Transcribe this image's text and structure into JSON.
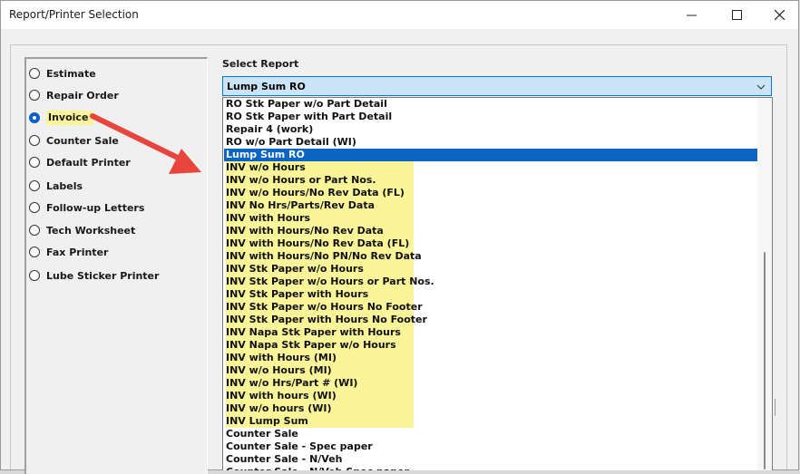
{
  "window": {
    "title": "Report/Printer Selection",
    "minimize_icon": "minimize-icon",
    "maximize_icon": "maximize-icon",
    "close_icon": "close-icon"
  },
  "report_group": {
    "options": [
      {
        "label": "Estimate",
        "checked": false
      },
      {
        "label": "Repair Order",
        "checked": false
      },
      {
        "label": "Invoice",
        "checked": true,
        "highlighted": true
      },
      {
        "label": "Counter Sale",
        "checked": false
      },
      {
        "label": "Default Printer",
        "checked": false
      },
      {
        "label": "Labels",
        "checked": false
      },
      {
        "label": "Follow-up Letters",
        "checked": false
      },
      {
        "label": "Tech Worksheet",
        "checked": false
      },
      {
        "label": "Fax Printer",
        "checked": false
      },
      {
        "label": "Lube Sticker Printer",
        "checked": false
      }
    ]
  },
  "select_report": {
    "label": "Select Report",
    "current_value": "Lump Sum RO",
    "items": [
      {
        "text": "RO Stk Paper w/o Part Detail"
      },
      {
        "text": "RO Stk Paper with Part Detail"
      },
      {
        "text": "Repair 4 (work)"
      },
      {
        "text": "RO w/o Part Detail (WI)"
      },
      {
        "text": "Lump Sum RO",
        "selected": true
      },
      {
        "text": "INV w/o Hours",
        "highlighted": true
      },
      {
        "text": "INV w/o Hours or Part Nos.",
        "highlighted": true
      },
      {
        "text": "INV w/o Hours/No Rev Data (FL)",
        "highlighted": true
      },
      {
        "text": "INV No Hrs/Parts/Rev Data",
        "highlighted": true
      },
      {
        "text": "INV with Hours",
        "highlighted": true
      },
      {
        "text": "INV with Hours/No Rev Data",
        "highlighted": true
      },
      {
        "text": "INV with Hours/No Rev Data (FL)",
        "highlighted": true
      },
      {
        "text": "INV with Hours/No PN/No Rev Data",
        "highlighted": true
      },
      {
        "text": "INV Stk Paper w/o Hours",
        "highlighted": true
      },
      {
        "text": "INV Stk Paper w/o Hours or Part Nos.",
        "highlighted": true
      },
      {
        "text": "INV Stk Paper with Hours",
        "highlighted": true
      },
      {
        "text": "INV Stk Paper w/o Hours No Footer",
        "highlighted": true
      },
      {
        "text": "INV Stk Paper with Hours No Footer",
        "highlighted": true
      },
      {
        "text": "INV Napa Stk Paper with Hours",
        "highlighted": true
      },
      {
        "text": "INV Napa Stk Paper w/o Hours",
        "highlighted": true
      },
      {
        "text": "INV with Hours (MI)",
        "highlighted": true
      },
      {
        "text": "INV w/o Hours (MI)",
        "highlighted": true
      },
      {
        "text": "INV w/o Hrs/Part # (WI)",
        "highlighted": true
      },
      {
        "text": "INV with hours (WI)",
        "highlighted": true
      },
      {
        "text": "INV w/o hours (WI)",
        "highlighted": true
      },
      {
        "text": "INV Lump Sum",
        "highlighted": true
      },
      {
        "text": "Counter Sale"
      },
      {
        "text": "Counter Sale - Spec paper"
      },
      {
        "text": "Counter Sale - N/Veh"
      },
      {
        "text": "Counter Sale - N/Veh Spec paper"
      }
    ]
  },
  "colors": {
    "highlight": "#fbf59a",
    "selection": "#0a64c2",
    "annotation_arrow": "#e8453c"
  }
}
